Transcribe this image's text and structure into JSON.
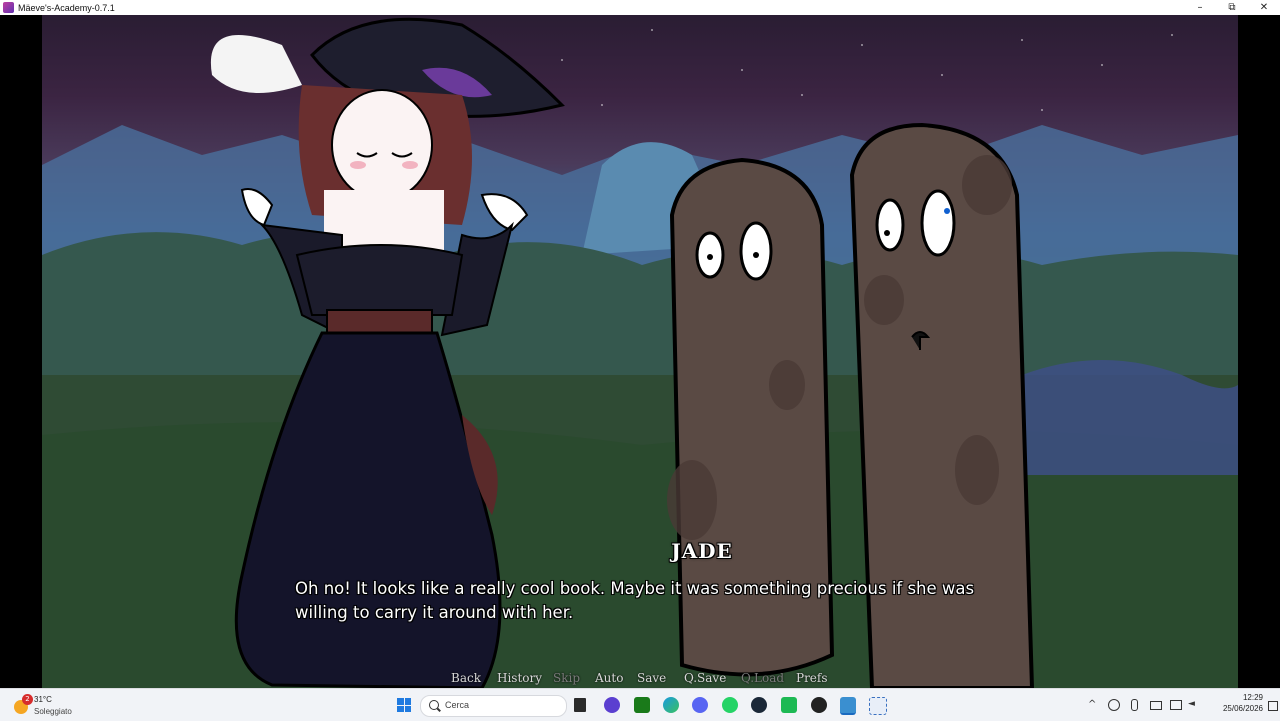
{
  "window": {
    "title": "Mäeve's-Academy-0.7.1",
    "minimize": "–",
    "maximize": "⧉",
    "close": "✕"
  },
  "dialogue": {
    "speaker": "JADE",
    "text": "Oh no! It looks like a really cool book. Maybe it was something precious if she was willing to carry it around with her."
  },
  "quick_menu": [
    {
      "label": "Back",
      "enabled": true
    },
    {
      "label": "History",
      "enabled": true
    },
    {
      "label": "Skip",
      "enabled": false
    },
    {
      "label": "Auto",
      "enabled": true
    },
    {
      "label": "Save",
      "enabled": true
    },
    {
      "label": "Q.Save",
      "enabled": true
    },
    {
      "label": "Q.Load",
      "enabled": false
    },
    {
      "label": "Prefs",
      "enabled": true
    }
  ],
  "taskbar": {
    "weather": {
      "temp": "31°C",
      "condition": "Soleggiato",
      "badge": "2"
    },
    "search_placeholder": "Cerca",
    "apps": [
      "file-explorer-icon",
      "proton-vpn-icon",
      "xbox-icon",
      "edge-icon",
      "discord-icon",
      "whatsapp-icon",
      "steam-icon",
      "spotify-icon",
      "obs-icon",
      "game-app-icon",
      "snipping-tool-icon"
    ],
    "tray": {
      "chevron": "^",
      "time": "12:29",
      "date": "25/06/2026"
    }
  }
}
